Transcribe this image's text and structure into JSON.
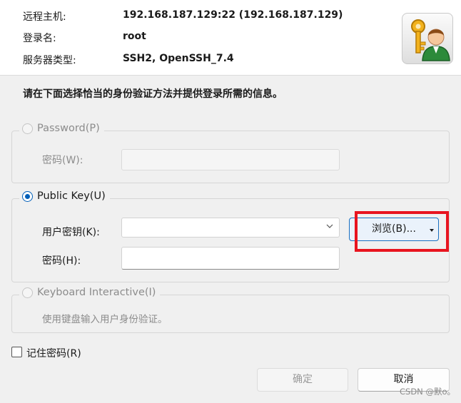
{
  "connection": {
    "host_label": "远程主机:",
    "host_value": "192.168.187.129:22 (192.168.187.129)",
    "user_label": "登录名:",
    "user_value": "root",
    "server_label": "服务器类型:",
    "server_value": "SSH2, OpenSSH_7.4",
    "logo_icon": "user-key-icon"
  },
  "instruction": "请在下面选择恰当的身份验证方法并提供登录所需的信息。",
  "password_method": {
    "label": "Password(P)",
    "selected": false,
    "enabled": false,
    "password_label": "密码(W):",
    "password_value": ""
  },
  "pubkey_method": {
    "label": "Public Key(U)",
    "selected": true,
    "enabled": true,
    "user_key_label": "用户密钥(K):",
    "user_key_value": "",
    "passphrase_label": "密码(H):",
    "passphrase_value": "",
    "browse_label": "浏览(B)..."
  },
  "keyboard_method": {
    "label": "Keyboard Interactive(I)",
    "selected": false,
    "enabled": false,
    "description": "使用键盘输入用户身份验证。"
  },
  "remember": {
    "label": "记住密码(R)",
    "checked": false
  },
  "buttons": {
    "ok": "确定",
    "cancel": "取消"
  },
  "watermark": "CSDN @默o。",
  "colors": {
    "accent": "#005fb8",
    "highlight": "#e8141f",
    "disabled_text": "#8c8c8c"
  }
}
